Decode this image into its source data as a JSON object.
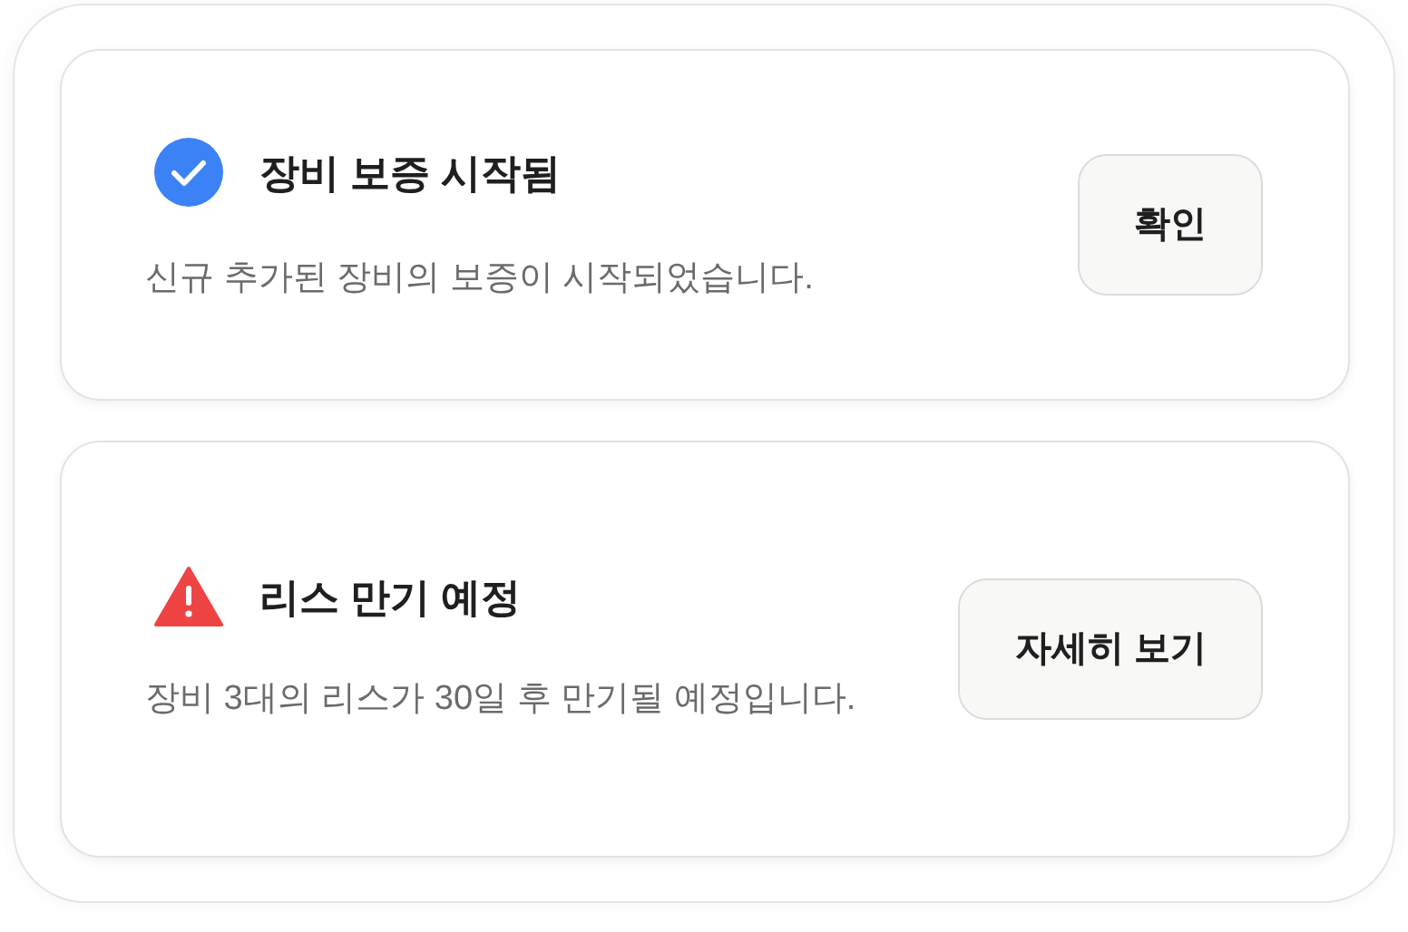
{
  "notifications": [
    {
      "kind": "success",
      "title": "장비 보증 시작됨",
      "message": "신규 추가된 장비의 보증이 시작되었습니다.",
      "action": "확인"
    },
    {
      "kind": "warning",
      "title": "리스 만기 예정",
      "message": "장비 3대의 리스가 30일 후 만기될 예정입니다.",
      "action": "자세히 보기"
    }
  ]
}
